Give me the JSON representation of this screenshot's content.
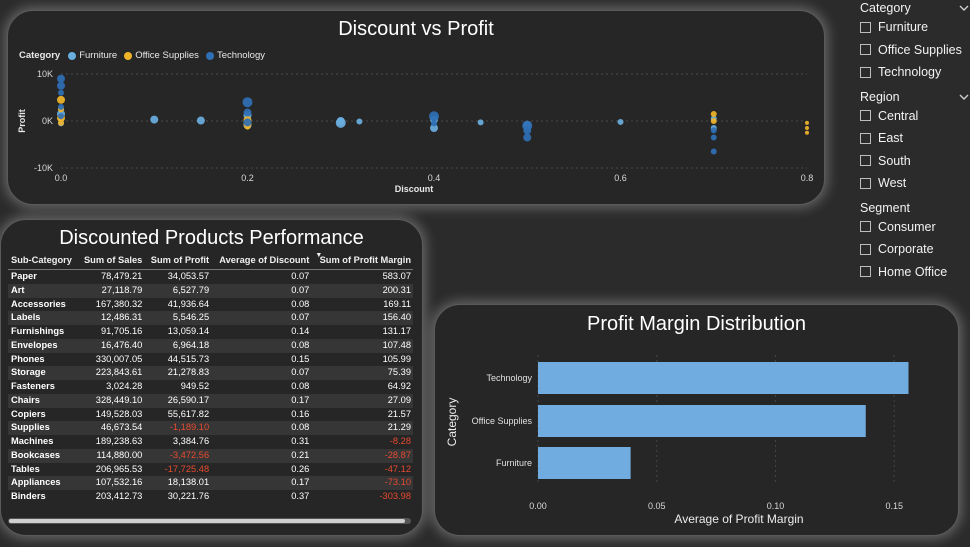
{
  "scatter": {
    "title": "Discount vs Profit",
    "legend_title": "Category",
    "legend": [
      {
        "name": "Furniture",
        "color": "#6aaee0"
      },
      {
        "name": "Office Supplies",
        "color": "#f0b429"
      },
      {
        "name": "Technology",
        "color": "#2f6fb5"
      }
    ]
  },
  "table": {
    "title": "Discounted Products Performance",
    "headers": [
      "Sub-Category",
      "Sum of Sales",
      "Sum of Profit",
      "Average of Discount",
      "Sum of Profit Margin"
    ],
    "rows": [
      [
        "Paper",
        "78,479.21",
        "34,053.57",
        "0.07",
        "583.07"
      ],
      [
        "Art",
        "27,118.79",
        "6,527.79",
        "0.07",
        "200.31"
      ],
      [
        "Accessories",
        "167,380.32",
        "41,936.64",
        "0.08",
        "169.11"
      ],
      [
        "Labels",
        "12,486.31",
        "5,546.25",
        "0.07",
        "156.40"
      ],
      [
        "Furnishings",
        "91,705.16",
        "13,059.14",
        "0.14",
        "131.17"
      ],
      [
        "Envelopes",
        "16,476.40",
        "6,964.18",
        "0.08",
        "107.48"
      ],
      [
        "Phones",
        "330,007.05",
        "44,515.73",
        "0.15",
        "105.99"
      ],
      [
        "Storage",
        "223,843.61",
        "21,278.83",
        "0.07",
        "75.39"
      ],
      [
        "Fasteners",
        "3,024.28",
        "949.52",
        "0.08",
        "64.92"
      ],
      [
        "Chairs",
        "328,449.10",
        "26,590.17",
        "0.17",
        "27.09"
      ],
      [
        "Copiers",
        "149,528.03",
        "55,617.82",
        "0.16",
        "21.57"
      ],
      [
        "Supplies",
        "46,673.54",
        "-1,189.10",
        "0.08",
        "21.29"
      ],
      [
        "Machines",
        "189,238.63",
        "3,384.76",
        "0.31",
        "-8.28"
      ],
      [
        "Bookcases",
        "114,880.00",
        "-3,472.56",
        "0.21",
        "-28.87"
      ],
      [
        "Tables",
        "206,965.53",
        "-17,725.48",
        "0.26",
        "-47.12"
      ],
      [
        "Appliances",
        "107,532.16",
        "18,138.01",
        "0.17",
        "-73.10"
      ],
      [
        "Binders",
        "203,412.73",
        "30,221.76",
        "0.37",
        "-303.98"
      ]
    ]
  },
  "bars": {
    "title": "Profit Margin Distribution",
    "ylabel": "Category",
    "xlabel": "Average of Profit Margin",
    "color": "#70ace0"
  },
  "filters": [
    {
      "title": "Category",
      "chevron": true,
      "items": [
        "Furniture",
        "Office Supplies",
        "Technology"
      ]
    },
    {
      "title": "Region",
      "chevron": true,
      "items": [
        "Central",
        "East",
        "South",
        "West"
      ]
    },
    {
      "title": "Segment",
      "chevron": false,
      "items": [
        "Consumer",
        "Corporate",
        "Home Office"
      ]
    }
  ],
  "chart_data": [
    {
      "type": "scatter",
      "title": "Discount vs Profit",
      "xlabel": "Discount",
      "ylabel": "Profit",
      "xlim": [
        0,
        0.8
      ],
      "ylim": [
        -10000,
        10000
      ],
      "x_ticks": [
        "0.0",
        "0.2",
        "0.4",
        "0.6",
        "0.8"
      ],
      "y_ticks": [
        "10K",
        "0K",
        "-10K"
      ],
      "grid": true,
      "legend_position": "top-left",
      "series": [
        {
          "name": "Furniture",
          "color": "#6aaee0",
          "points": [
            [
              0.0,
              1500,
              4
            ],
            [
              0.0,
              300,
              3
            ],
            [
              0.0,
              -500,
              3
            ],
            [
              0.0,
              2500,
              3
            ],
            [
              0.1,
              300,
              4
            ],
            [
              0.15,
              100,
              4
            ],
            [
              0.2,
              1200,
              4
            ],
            [
              0.2,
              -300,
              4
            ],
            [
              0.2,
              -900,
              4
            ],
            [
              0.3,
              0,
              4
            ],
            [
              0.3,
              -400,
              5
            ],
            [
              0.32,
              -100,
              3
            ],
            [
              0.4,
              300,
              4
            ],
            [
              0.4,
              -1500,
              4
            ],
            [
              0.45,
              -300,
              3
            ],
            [
              0.5,
              -800,
              4
            ],
            [
              0.6,
              -200,
              3
            ],
            [
              0.7,
              -1500,
              3
            ],
            [
              0.7,
              500,
              3
            ]
          ]
        },
        {
          "name": "Office Supplies",
          "color": "#f0b429",
          "points": [
            [
              0.0,
              4500,
              4
            ],
            [
              0.0,
              2500,
              3
            ],
            [
              0.0,
              600,
              4
            ],
            [
              0.0,
              -400,
              3
            ],
            [
              0.2,
              200,
              4
            ],
            [
              0.2,
              -700,
              4
            ],
            [
              0.2,
              -1200,
              3
            ],
            [
              0.7,
              1500,
              3
            ],
            [
              0.7,
              0,
              3
            ],
            [
              0.8,
              -400,
              2
            ],
            [
              0.8,
              -1500,
              2
            ],
            [
              0.8,
              -2500,
              2
            ]
          ]
        },
        {
          "name": "Technology",
          "color": "#2f6fb5",
          "points": [
            [
              0.0,
              9000,
              4
            ],
            [
              0.0,
              7500,
              4
            ],
            [
              0.0,
              6000,
              3
            ],
            [
              0.0,
              3000,
              3
            ],
            [
              0.0,
              1000,
              3
            ],
            [
              0.2,
              4000,
              5
            ],
            [
              0.2,
              1800,
              4
            ],
            [
              0.2,
              -300,
              4
            ],
            [
              0.4,
              1000,
              5
            ],
            [
              0.4,
              -500,
              3
            ],
            [
              0.5,
              -1000,
              5
            ],
            [
              0.5,
              -2000,
              4
            ],
            [
              0.5,
              -3500,
              4
            ],
            [
              0.7,
              -2000,
              3
            ],
            [
              0.7,
              -3500,
              3
            ],
            [
              0.7,
              -6500,
              3
            ]
          ]
        }
      ]
    },
    {
      "type": "bar",
      "orientation": "horizontal",
      "title": "Profit Margin Distribution",
      "xlabel": "Average of Profit Margin",
      "ylabel": "Category",
      "categories": [
        "Technology",
        "Office Supplies",
        "Furniture"
      ],
      "values": [
        0.156,
        0.138,
        0.039
      ],
      "xlim": [
        0,
        0.16
      ],
      "x_ticks": [
        "0.00",
        "0.05",
        "0.10",
        "0.15"
      ]
    }
  ]
}
